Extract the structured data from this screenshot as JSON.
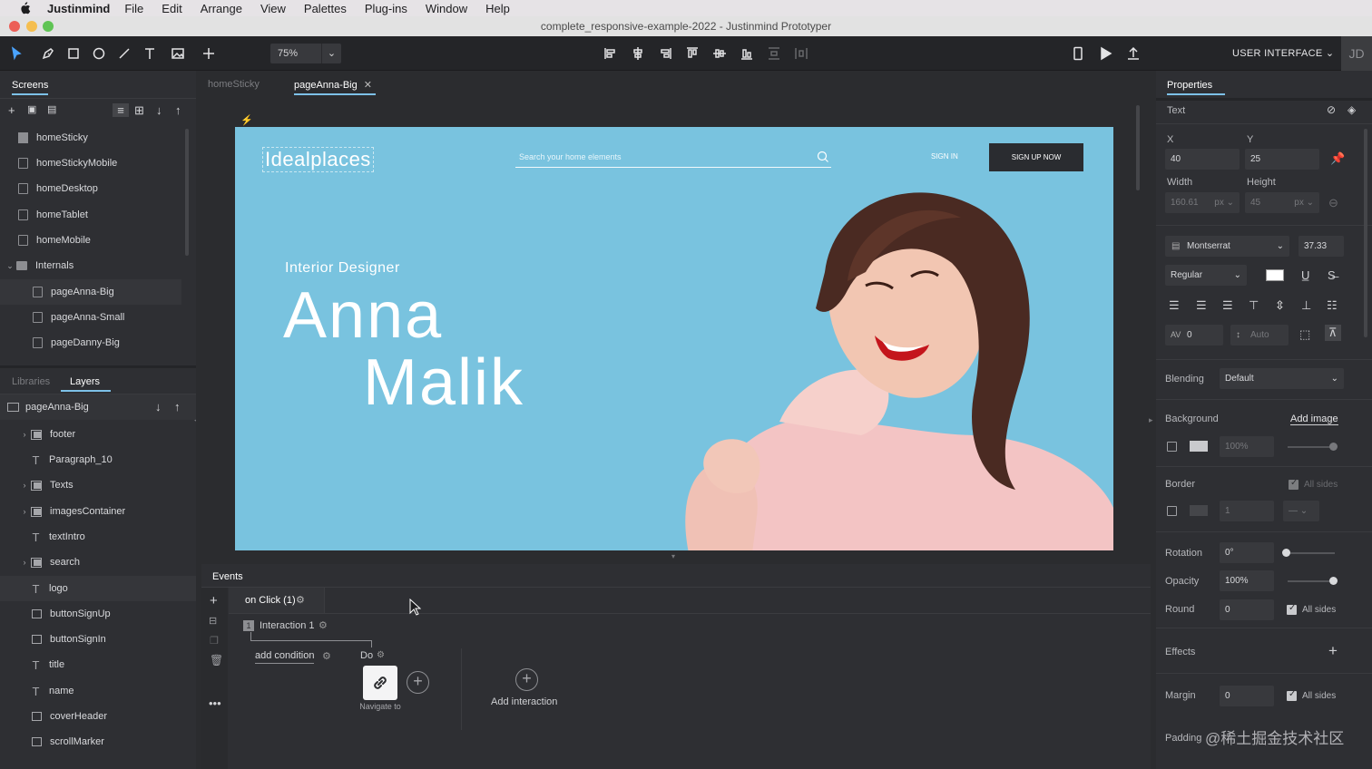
{
  "menubar": {
    "app": "Justinmind",
    "items": [
      "File",
      "Edit",
      "Arrange",
      "View",
      "Palettes",
      "Plug-ins",
      "Window",
      "Help"
    ]
  },
  "window": {
    "title": "complete_responsive-example-2022 - Justinmind Prototyper"
  },
  "toolbar": {
    "zoom": "75%",
    "mode": "USER INTERFACE",
    "avatar": "JD"
  },
  "screens_panel": {
    "tab": "Screens",
    "items": [
      {
        "label": "homeSticky"
      },
      {
        "label": "homeStickyMobile"
      },
      {
        "label": "homeDesktop"
      },
      {
        "label": "homeTablet"
      },
      {
        "label": "homeMobile"
      },
      {
        "label": "Internals"
      },
      {
        "label": "pageAnna-Big"
      },
      {
        "label": "pageAnna-Small"
      },
      {
        "label": "pageDanny-Big"
      }
    ]
  },
  "layers_panel": {
    "tabs": [
      "Libraries",
      "Layers"
    ],
    "root": "pageAnna-Big",
    "items": [
      {
        "label": "footer"
      },
      {
        "label": "Paragraph_10"
      },
      {
        "label": "Texts"
      },
      {
        "label": "imagesContainer"
      },
      {
        "label": "textIntro"
      },
      {
        "label": "search"
      },
      {
        "label": "logo"
      },
      {
        "label": "buttonSignUp"
      },
      {
        "label": "buttonSignIn"
      },
      {
        "label": "title"
      },
      {
        "label": "name"
      },
      {
        "label": "coverHeader"
      },
      {
        "label": "scrollMarker"
      }
    ]
  },
  "canvas": {
    "tabs": [
      "homeSticky",
      "pageAnna-Big"
    ],
    "artboard": {
      "brand": "Idealplaces",
      "search_placeholder": "Search your home elements",
      "signin": "SIGN IN",
      "signup": "SIGN UP NOW",
      "intro": "Interior Designer",
      "first_name": "Anna",
      "last_name": "Malik"
    }
  },
  "events": {
    "tab": "Events",
    "trigger": "on Click (1)",
    "interaction": "Interaction 1",
    "add_condition": "add condition",
    "do": "Do",
    "action": "Navigate to",
    "add_interaction": "Add interaction"
  },
  "properties": {
    "tab": "Properties",
    "section": "Text",
    "x_label": "X",
    "y_label": "Y",
    "x": "40",
    "y": "25",
    "width_label": "Width",
    "height_label": "Height",
    "width": "160.61",
    "height": "45",
    "unit": "px",
    "font": "Montserrat",
    "font_size": "37.33",
    "weight": "Regular",
    "spacing": "0",
    "line_height": "Auto",
    "blending_label": "Blending",
    "blending": "Default",
    "background_label": "Background",
    "add_image": "Add image",
    "bg_opacity": "100%",
    "border_label": "Border",
    "all_sides": "All sides",
    "border_width": "1",
    "rotation_label": "Rotation",
    "rotation": "0°",
    "opacity_label": "Opacity",
    "opacity": "100%",
    "round_label": "Round",
    "round": "0",
    "effects_label": "Effects",
    "margin_label": "Margin",
    "margin": "0",
    "padding_label": "Padding"
  },
  "watermark": "@稀土掘金技术社区",
  "colors": {
    "accent": "#7dc1e8",
    "artboard_bg": "#79c3df",
    "close": "#ec5f57",
    "minimize": "#f5be4f",
    "zoom": "#5fc454"
  }
}
